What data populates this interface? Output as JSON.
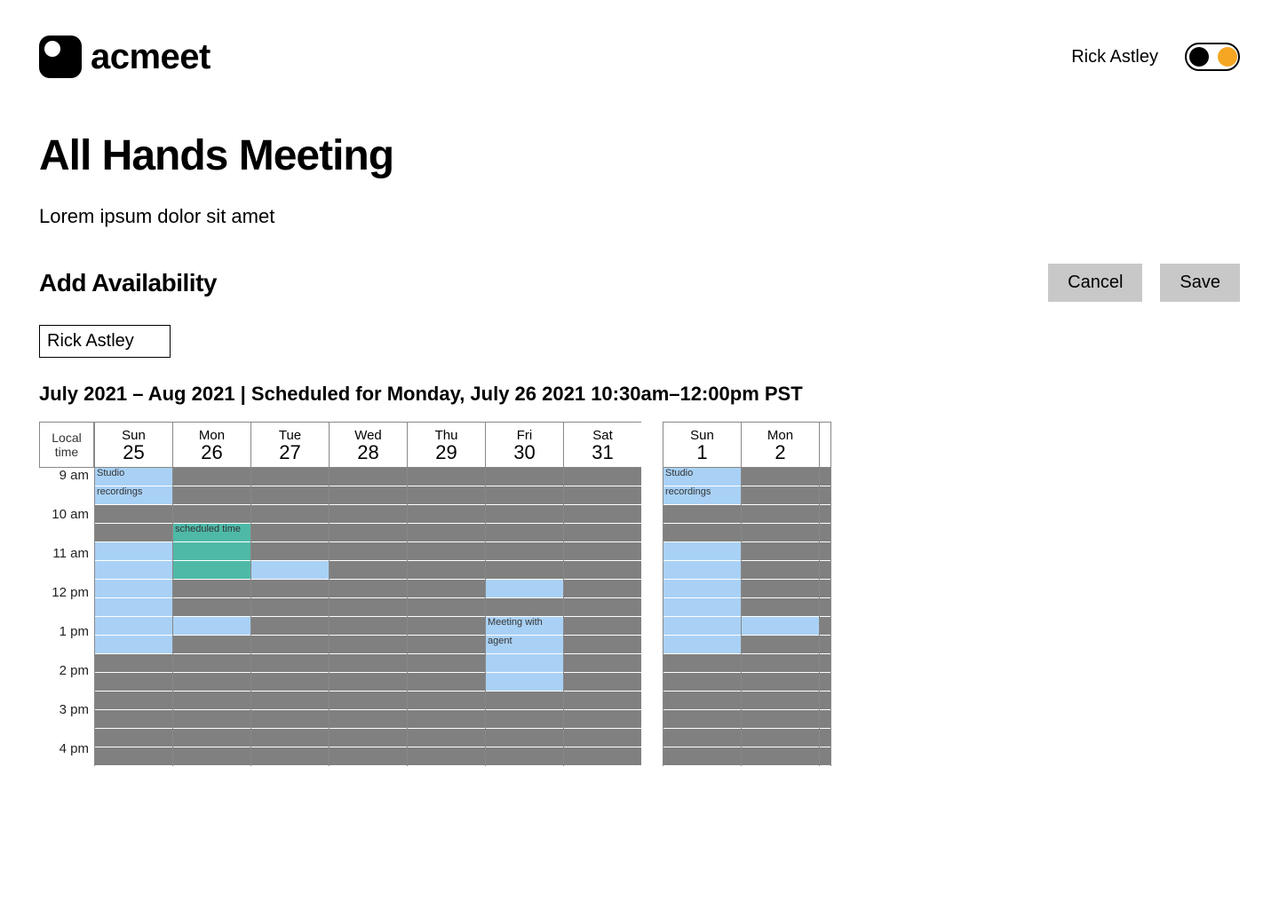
{
  "brand": "acmeet",
  "user_name": "Rick Astley",
  "meeting": {
    "title": "All Hands Meeting",
    "description": "Lorem ipsum dolor sit amet"
  },
  "section_title": "Add Availability",
  "buttons": {
    "cancel": "Cancel",
    "save": "Save"
  },
  "chip_name": "Rick Astley",
  "schedule_line": "July 2021 – Aug  2021 | Scheduled for Monday, July 26 2021 10:30am–12:00pm PST",
  "time_header": {
    "l1": "Local",
    "l2": "time"
  },
  "hours": [
    "9 am",
    "10 am",
    "11 am",
    "12 pm",
    "1 pm",
    "2 pm",
    "3 pm",
    "4 pm"
  ],
  "days": [
    {
      "dow": "Sun",
      "num": "25"
    },
    {
      "dow": "Mon",
      "num": "26"
    },
    {
      "dow": "Tue",
      "num": "27"
    },
    {
      "dow": "Wed",
      "num": "28"
    },
    {
      "dow": "Thu",
      "num": "29"
    },
    {
      "dow": "Fri",
      "num": "30"
    },
    {
      "dow": "Sat",
      "num": "31"
    },
    {
      "dow": "Sun",
      "num": "1",
      "newweek": true
    },
    {
      "dow": "Mon",
      "num": "2"
    }
  ],
  "slot_colors": {
    "busy": "#808080",
    "avail": "#a9d1f5",
    "sched": "#4fb9a8"
  },
  "cells": {
    "comment": "key = dayIndex_slotIndex (slot 0 = 9:00, slot 1 = 9:30, ...). value = class + optional label",
    "0_0": {
      "c": "avail",
      "t": "Studio"
    },
    "0_1": {
      "c": "avail",
      "t": "recordings"
    },
    "0_4": {
      "c": "avail"
    },
    "0_5": {
      "c": "avail"
    },
    "0_6": {
      "c": "avail"
    },
    "0_7": {
      "c": "avail"
    },
    "0_8": {
      "c": "avail"
    },
    "0_9": {
      "c": "avail"
    },
    "1_3": {
      "c": "sched",
      "t": "scheduled time"
    },
    "1_4": {
      "c": "sched"
    },
    "1_5": {
      "c": "sched"
    },
    "1_8": {
      "c": "avail"
    },
    "2_5": {
      "c": "avail"
    },
    "5_6": {
      "c": "avail"
    },
    "5_8": {
      "c": "avail",
      "t": "Meeting with"
    },
    "5_9": {
      "c": "avail",
      "t": "agent"
    },
    "5_10": {
      "c": "avail"
    },
    "5_11": {
      "c": "avail"
    },
    "7_0": {
      "c": "avail",
      "t": "Studio"
    },
    "7_1": {
      "c": "avail",
      "t": "recordings"
    },
    "7_4": {
      "c": "avail"
    },
    "7_5": {
      "c": "avail"
    },
    "7_6": {
      "c": "avail"
    },
    "7_7": {
      "c": "avail"
    },
    "7_8": {
      "c": "avail"
    },
    "7_9": {
      "c": "avail"
    },
    "8_8": {
      "c": "avail"
    }
  },
  "slots_per_day": 16
}
